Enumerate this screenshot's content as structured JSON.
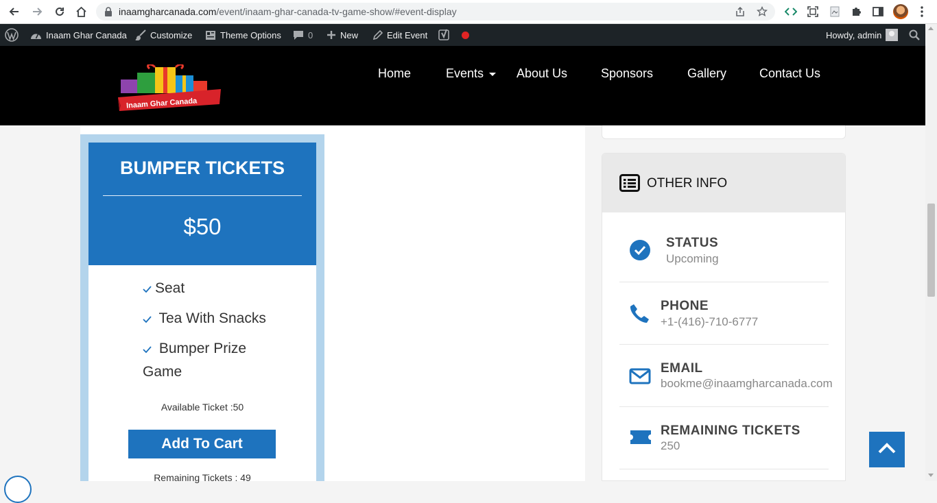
{
  "browser": {
    "url_host": "inaamgharcanada.com",
    "url_path": "/event/inaam-ghar-canada-tv-game-show/#event-display"
  },
  "adminbar": {
    "site_name": "Inaam Ghar Canada",
    "customize": "Customize",
    "theme_options": "Theme Options",
    "comments_count": "0",
    "new": "New",
    "edit_event": "Edit Event",
    "howdy": "Howdy, admin"
  },
  "header": {
    "logo_text": "Inaam Ghar Canada",
    "nav": [
      "Home",
      "Events",
      "About Us",
      "Sponsors",
      "Gallery",
      "Contact Us"
    ]
  },
  "ticket": {
    "title": "BUMPER TICKETS",
    "price": "$50",
    "features": [
      "Seat",
      "Tea With Snacks",
      "Bumper Prize Game"
    ],
    "available": "Available Ticket :50",
    "add_to_cart": "Add To Cart",
    "remaining": "Remaining Tickets : 49"
  },
  "other_info": {
    "title": "OTHER INFO",
    "items": [
      {
        "label": "STATUS",
        "value": "Upcoming"
      },
      {
        "label": "PHONE",
        "value": "+1-(416)-710-6777"
      },
      {
        "label": "EMAIL",
        "value": "bookme@inaamgharcanada.com"
      },
      {
        "label": "REMAINING TICKETS",
        "value": "250"
      }
    ]
  },
  "colors": {
    "accent": "#1e73be",
    "ticket_frame": "#b3d4ec",
    "header_bg": "#000000",
    "adminbar_bg": "#1d2327"
  }
}
